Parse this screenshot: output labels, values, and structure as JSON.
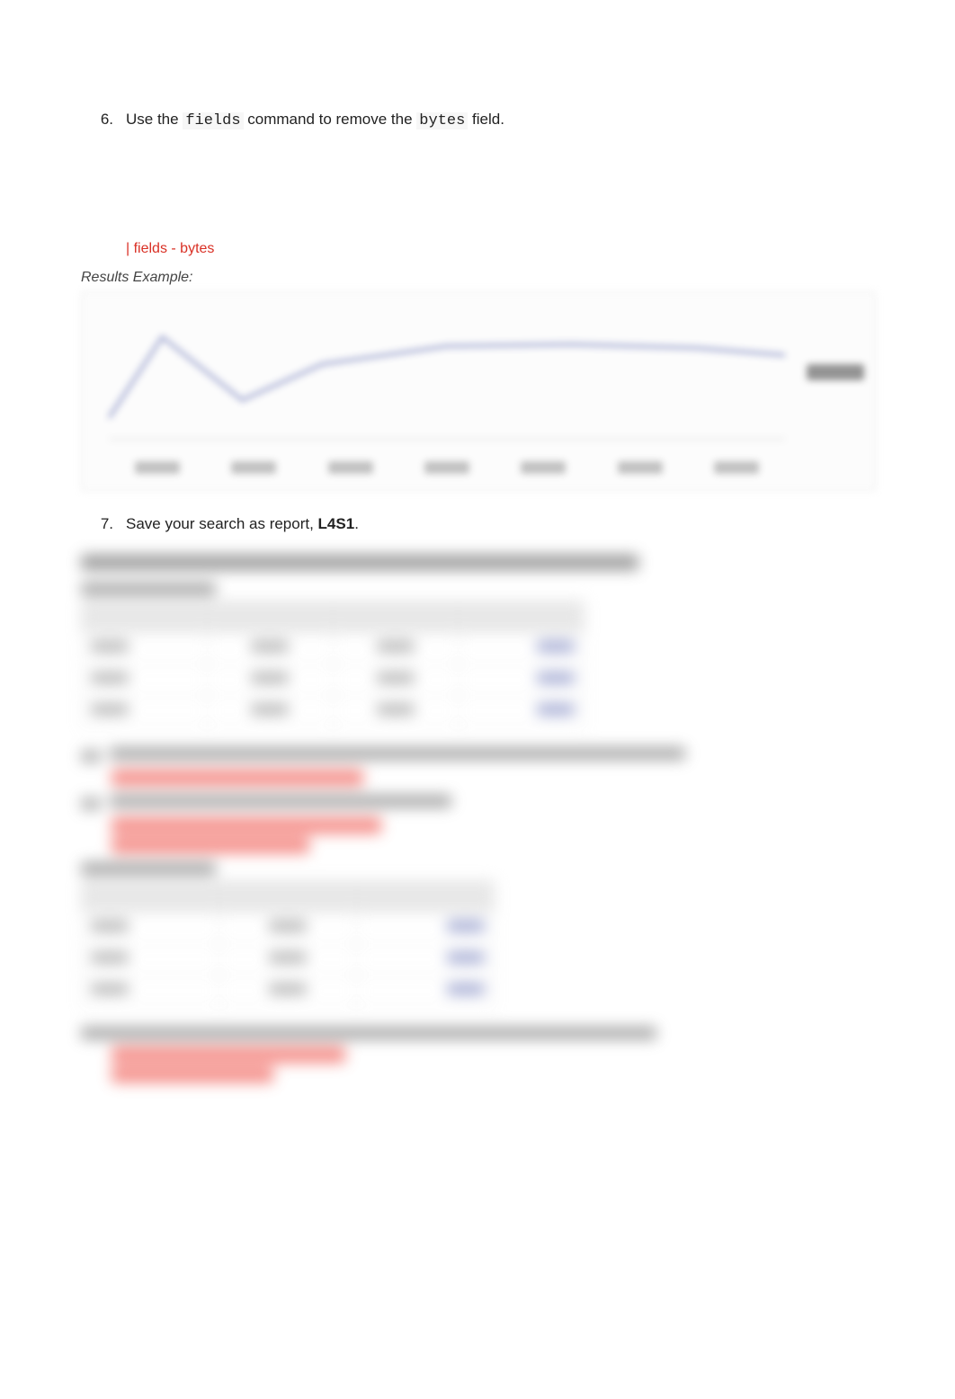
{
  "step6": {
    "number": "6.",
    "prefix": "Use the ",
    "cmd1": "fields",
    "middle": " command to remove the ",
    "cmd2": "bytes",
    "suffix": " field."
  },
  "answer": "| fields - bytes",
  "results_label": "Results Example:",
  "step7": {
    "number": "7.",
    "prefix": "Save your search as report, ",
    "report_name": "L4S1",
    "suffix": "."
  }
}
